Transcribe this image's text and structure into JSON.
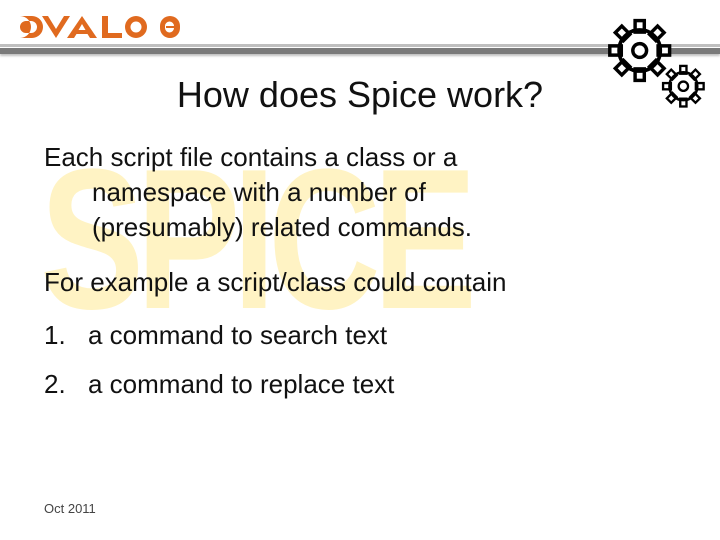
{
  "brand": "DYALOG",
  "title": "How does Spice work?",
  "para1_line1": "Each script file contains a class or a",
  "para1_line2": "namespace with a number of",
  "para1_line3": "(presumably) related commands.",
  "para2": "For example a script/class could contain",
  "list": [
    {
      "n": "1.",
      "text": "a command to search text"
    },
    {
      "n": "2.",
      "text": "a command to replace text"
    }
  ],
  "footer": "Oct  2011",
  "watermark": "SPICE"
}
